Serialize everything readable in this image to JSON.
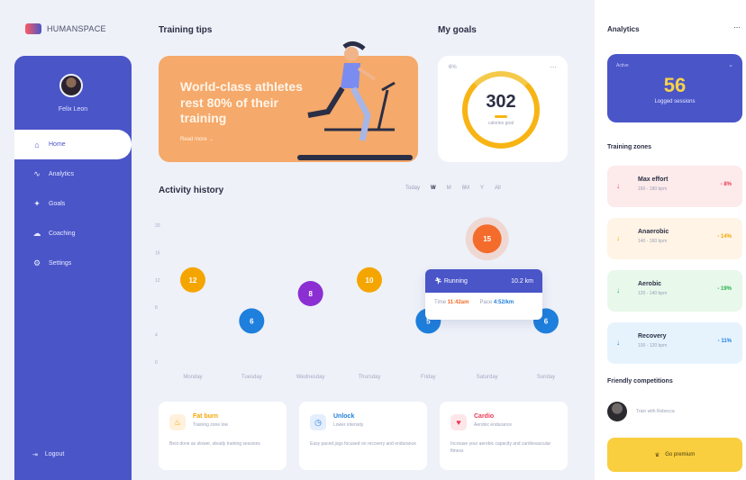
{
  "brand": {
    "name": "HUMANSPACE"
  },
  "profile": {
    "name": "Felix Leon"
  },
  "nav": [
    {
      "icon": "home-icon",
      "glyph": "⌂",
      "label": "Home",
      "active": true
    },
    {
      "icon": "analytics-icon",
      "glyph": "∿",
      "label": "Analytics"
    },
    {
      "icon": "goals-icon",
      "glyph": "✦",
      "label": "Goals"
    },
    {
      "icon": "coaching-icon",
      "glyph": "☁",
      "label": "Coaching"
    },
    {
      "icon": "settings-icon",
      "glyph": "⚙",
      "label": "Settings"
    }
  ],
  "logout": {
    "label": "Logout"
  },
  "training_tips": {
    "title": "Training tips",
    "text": "World-class athletes rest 80% of their training",
    "link": "Read more →"
  },
  "goals": {
    "title": "My goals",
    "tag": "6%",
    "value": "302",
    "sub": "calories goal",
    "progress": 0.8
  },
  "activity": {
    "title": "Activity history",
    "filters": [
      "Today",
      "W",
      "M",
      "6M",
      "Y",
      "All"
    ],
    "active_filter": "W",
    "tooltip": {
      "name": "Running",
      "distance": "10.2 km",
      "time_label": "Time",
      "time_value": "11:42am",
      "pace_label": "Pace",
      "pace_value": "4:52/km"
    }
  },
  "chart_data": {
    "type": "scatter",
    "title": "Activity history",
    "x_labels": [
      "Monday",
      "Tuesday",
      "Wednesday",
      "Thursday",
      "Friday",
      "Saturday",
      "Sunday"
    ],
    "y_ticks": [
      0,
      4,
      8,
      12,
      16,
      20
    ],
    "ylim": [
      0,
      20
    ],
    "points": [
      {
        "x": "Monday",
        "y": 12,
        "label": "12",
        "color": "#f5a500"
      },
      {
        "x": "Tuesday",
        "y": 6,
        "label": "6",
        "color": "#1e7fdc"
      },
      {
        "x": "Wednesday",
        "y": 10,
        "label": "8",
        "color": "#8b2fd3"
      },
      {
        "x": "Thursday",
        "y": 12,
        "label": "10",
        "color": "#f5a500"
      },
      {
        "x": "Friday",
        "y": 6,
        "label": "5",
        "color": "#1e7fdc"
      },
      {
        "x": "Saturday",
        "y": 18,
        "label": "15",
        "color": "#f46c2b"
      },
      {
        "x": "Sunday",
        "y": 6,
        "label": "6",
        "color": "#1e7fdc"
      }
    ]
  },
  "activity_cards": [
    {
      "icon": "flame-icon",
      "glyph": "♨",
      "bg": "#fff1dc",
      "fg": "#f5a500",
      "title": "Fat burn",
      "sub": "Training zone low",
      "desc": "Best done as slower, steady training sessions"
    },
    {
      "icon": "stopwatch-icon",
      "glyph": "◷",
      "bg": "#e4eefd",
      "fg": "#1e7fdc",
      "title": "Unlock",
      "sub": "Lower intensity",
      "desc": "Easy paced jogs focused on recovery and endurance"
    },
    {
      "icon": "heart-icon",
      "glyph": "♥",
      "bg": "#fde6ea",
      "fg": "#ea3a55",
      "title": "Cardio",
      "sub": "Aerobic endurance",
      "desc": "Increase your aerobic capacity and cardiovascular fitness"
    }
  ],
  "analytics": {
    "title": "Analytics",
    "tag": "Active",
    "value": "56",
    "sub": "Logged sessions"
  },
  "zones": {
    "title": "Training zones",
    "items": [
      {
        "name": "Max effort",
        "range": "160 - 180 bpm",
        "pct": "- 8%",
        "bg": "#fdeaea",
        "fg": "#ea3a55"
      },
      {
        "name": "Anaerobic",
        "range": "140 - 160 bpm",
        "pct": "- 14%",
        "bg": "#fff4e5",
        "fg": "#f5a500"
      },
      {
        "name": "Aerobic",
        "range": "120 - 140 bpm",
        "pct": "- 19%",
        "bg": "#e8f8ea",
        "fg": "#26b04a"
      },
      {
        "name": "Recovery",
        "range": "100 - 120 bpm",
        "pct": "- 11%",
        "bg": "#e6f3fd",
        "fg": "#1e7fdc"
      }
    ]
  },
  "competitions": {
    "title": "Friendly competitions",
    "entry": "Train with Rebecca"
  },
  "pro_button": {
    "label": "Go premium"
  }
}
